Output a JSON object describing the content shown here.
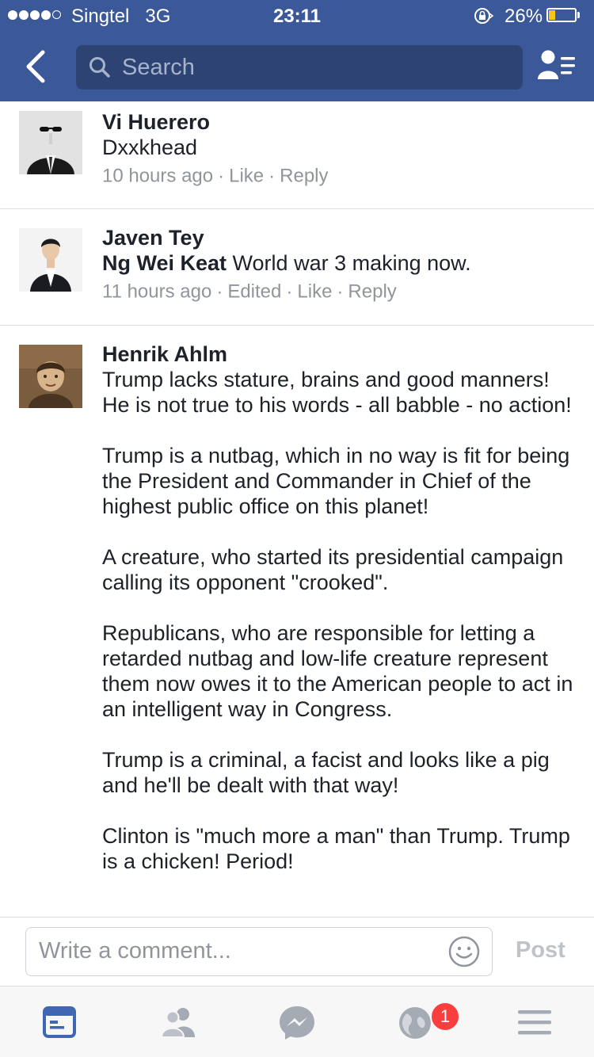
{
  "status_bar": {
    "carrier": "Singtel",
    "network": "3G",
    "time": "23:11",
    "battery_pct": "26%",
    "battery_level": 0.26
  },
  "nav": {
    "search_placeholder": "Search"
  },
  "comments": [
    {
      "author": "Vi Huerero",
      "mention": "",
      "text": "Dxxkhead",
      "time": "10 hours ago",
      "edited": "",
      "like": "Like",
      "reply": "Reply"
    },
    {
      "author": "Javen Tey",
      "mention": "Ng Wei Keat",
      "text": "World war 3 making now.",
      "time": "11 hours ago",
      "edited": "Edited",
      "like": "Like",
      "reply": "Reply"
    },
    {
      "author": "Henrik Ahlm",
      "mention": "",
      "text": "Trump lacks stature, brains and good manners! He is not true to his words - all babble - no action!\n\nTrump is a nutbag, which in no way is fit for being the President and Commander in Chief of the highest public office on this planet!\n\nA creature, who started its presidential campaign calling its opponent \"crooked\".\n\nRepublicans, who are responsible for letting a retarded nutbag and low-life creature represent them now owes it to the American people to act in an intelligent way in Congress.\n\nTrump is a criminal, a facist and looks like a pig and he'll be dealt with that way!\n\nClinton is \"much more a man\" than Trump. Trump is a chicken! Period!"
    }
  ],
  "composer": {
    "placeholder": "Write a comment...",
    "post_label": "Post"
  },
  "tabbar": {
    "notifications_badge": "1"
  },
  "icons": [
    "back-chevron-icon",
    "search-icon",
    "friends-list-icon",
    "emoji-icon",
    "news-feed-icon",
    "friend-requests-icon",
    "messenger-icon",
    "globe-notifications-icon",
    "menu-icon"
  ],
  "colors": {
    "brand": "#3b5998",
    "link": "#3b5998",
    "badge": "#fa3e3e",
    "meta": "#90949c"
  }
}
